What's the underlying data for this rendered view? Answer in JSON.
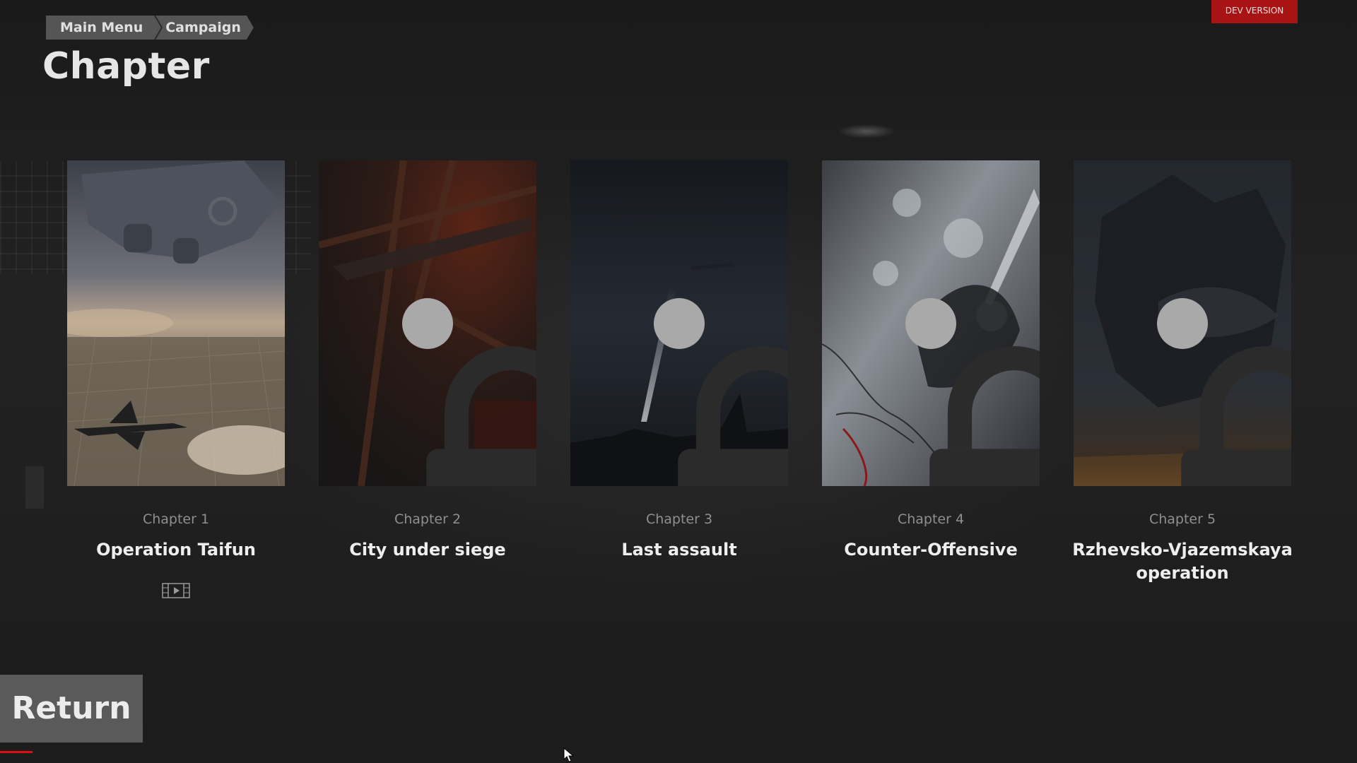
{
  "breadcrumb": {
    "items": [
      "Main Menu",
      "Campaign"
    ]
  },
  "page": {
    "title": "Chapter"
  },
  "badge": {
    "label": "DEV VERSION",
    "color": "#a81414"
  },
  "chapters": [
    {
      "number": "Chapter 1",
      "title": "Operation Taifun",
      "locked": false,
      "has_video": true,
      "icon": "film-icon"
    },
    {
      "number": "Chapter 2",
      "title": "City under siege",
      "locked": true,
      "icon": "lock-icon"
    },
    {
      "number": "Chapter 3",
      "title": "Last assault",
      "locked": true,
      "icon": "lock-icon"
    },
    {
      "number": "Chapter 4",
      "title": "Counter-Offensive",
      "locked": true,
      "icon": "lock-icon"
    },
    {
      "number": "Chapter 5",
      "title": "Rzhevsko-Vjazemskaya operation",
      "locked": true,
      "icon": "lock-icon"
    }
  ],
  "footer": {
    "return_label": "Return"
  },
  "theme": {
    "background": "#1d1d1d",
    "button": "#5a5a5a",
    "lock": "#a9a9a9"
  }
}
